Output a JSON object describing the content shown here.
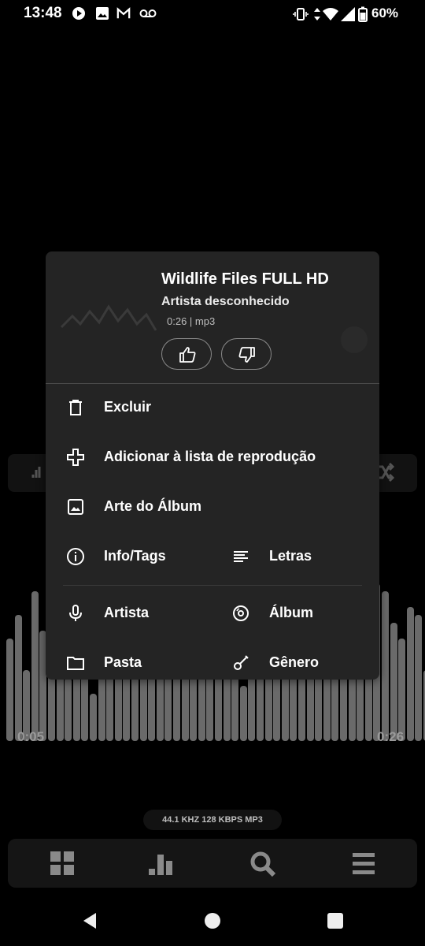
{
  "status_bar": {
    "time": "13:48",
    "battery_percent": "60%",
    "left_icons": [
      "play-icon",
      "image-icon",
      "gmail-icon",
      "voicemail-icon"
    ],
    "right_icons": [
      "vibrate-icon",
      "data-icon",
      "wifi-icon",
      "signal-icon",
      "battery-icon"
    ]
  },
  "player": {
    "elapsed": "0:05",
    "duration": "0:26",
    "quality": "44.1 KHZ  128 KBPS  MP3",
    "bottom_nav": [
      "grid-icon",
      "bar-chart-icon",
      "search-icon",
      "menu-icon"
    ]
  },
  "dialog": {
    "title": "Wildlife Files FULL HD",
    "artist": "Artista desconhecido",
    "meta": "0:26 | mp3",
    "items": {
      "delete": "Excluir",
      "add_to_playlist": "Adicionar à lista de reprodução",
      "album_art": "Arte do Álbum",
      "info_tags": "Info/Tags",
      "lyrics": "Letras",
      "artist": "Artista",
      "album": "Álbum",
      "folder": "Pasta",
      "genre": "Gênero"
    }
  },
  "colors": {
    "background": "#000000",
    "dialog": "#242424",
    "text": "#ffffff",
    "muted": "#9a9a9a"
  }
}
